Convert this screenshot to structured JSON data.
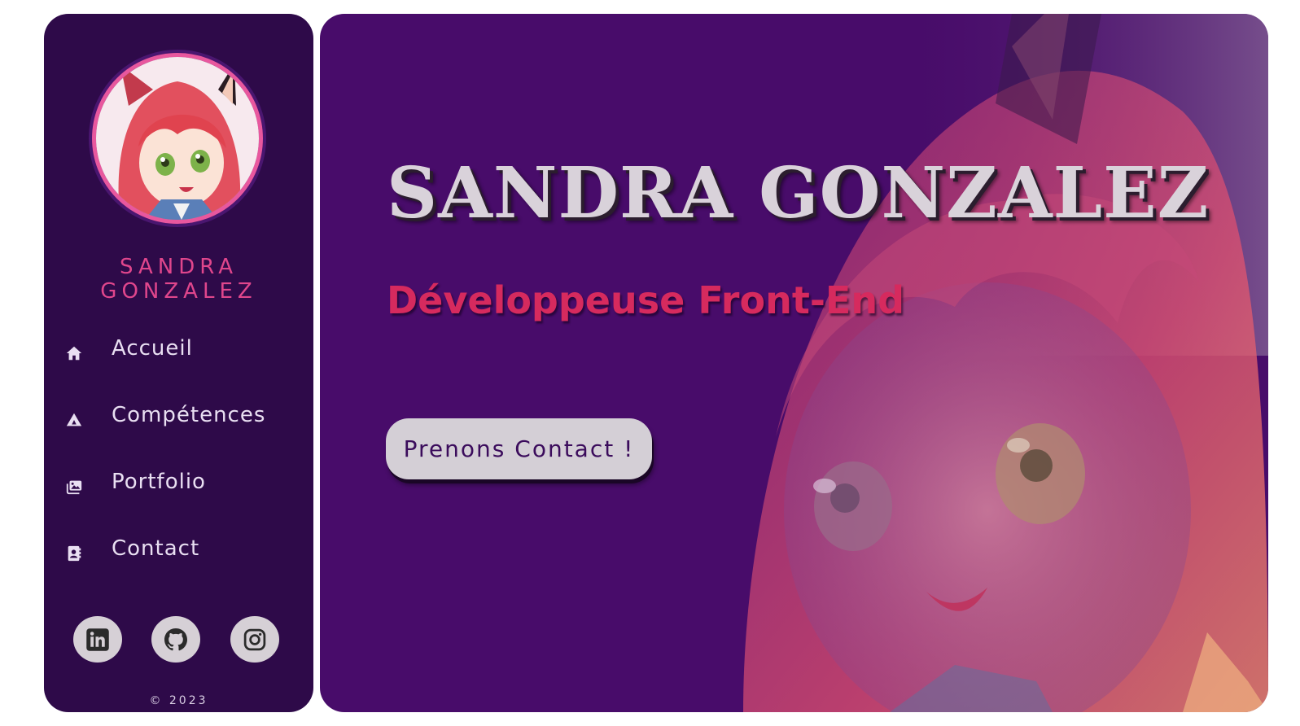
{
  "sidebar": {
    "name": "SANDRA GONZALEZ",
    "nav": [
      {
        "label": "Accueil",
        "icon": "home-icon"
      },
      {
        "label": "Compétences",
        "icon": "triangle-icon"
      },
      {
        "label": "Portfolio",
        "icon": "images-icon"
      },
      {
        "label": "Contact",
        "icon": "contact-card-icon"
      }
    ],
    "socials": [
      {
        "icon": "linkedin-icon"
      },
      {
        "icon": "github-icon"
      },
      {
        "icon": "instagram-icon"
      }
    ],
    "copyright": "© 2023"
  },
  "hero": {
    "title": "SANDRA GONZALEZ",
    "subtitle": "Développeuse Front-End",
    "cta_label": "Prenons Contact !"
  },
  "colors": {
    "sidebar_bg": "#2e0a49",
    "main_bg": "#480c6a",
    "accent_pink": "#e0468c",
    "subtitle_red": "#d62a5e",
    "title_light": "#d9d2da",
    "button_bg": "#d4cfd6"
  }
}
